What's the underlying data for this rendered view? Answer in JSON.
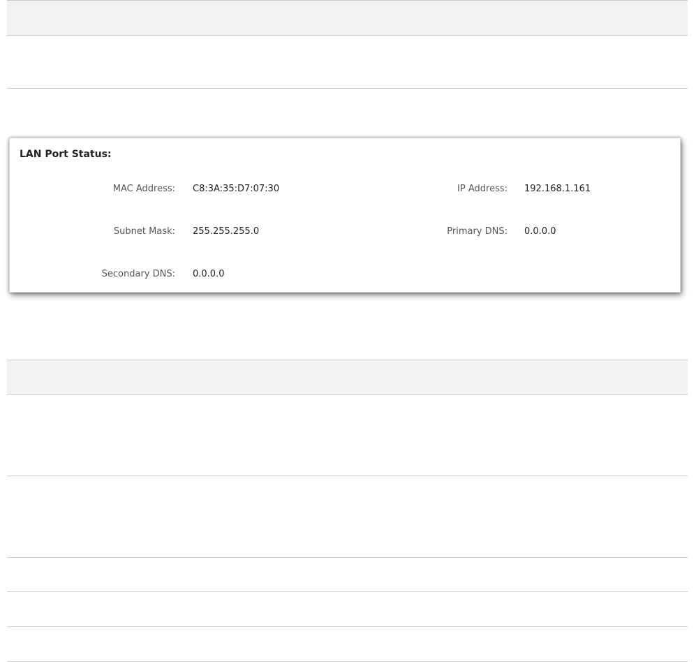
{
  "lan_port_status": {
    "title": "LAN Port Status:",
    "fields": [
      {
        "label": "MAC Address:",
        "value": "C8:3A:35:D7:07:30"
      },
      {
        "label": "IP Address:",
        "value": "192.168.1.161"
      },
      {
        "label": "Subnet Mask:",
        "value": "255.255.255.0"
      },
      {
        "label": "Primary DNS:",
        "value": "0.0.0.0"
      },
      {
        "label": "Secondary DNS:",
        "value": "0.0.0.0"
      }
    ]
  },
  "colors": {
    "header_band": "#f2f2f2",
    "divider": "#c8c8c8",
    "panel_bg": "#ffffff",
    "text": "#333333"
  }
}
